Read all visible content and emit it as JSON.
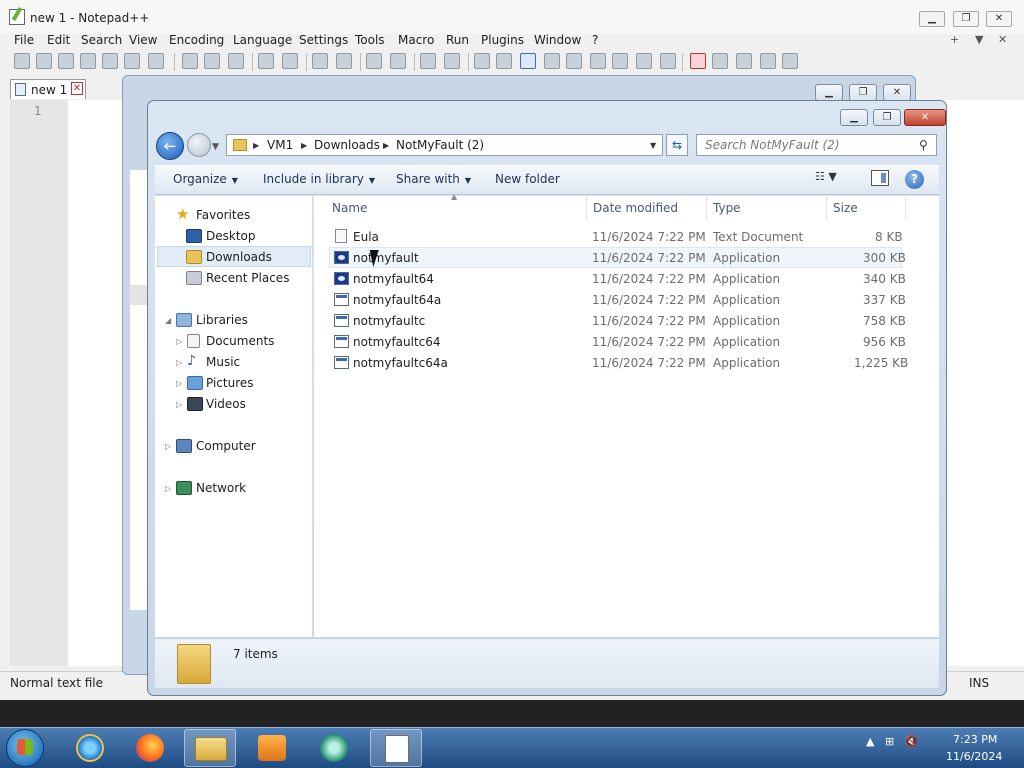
{
  "notepad": {
    "title": "new 1 - Notepad++",
    "menu": [
      "File",
      "Edit",
      "Search",
      "View",
      "Encoding",
      "Language",
      "Settings",
      "Tools",
      "Macro",
      "Run",
      "Plugins",
      "Window",
      "?"
    ],
    "menu_right": [
      "+",
      "▼",
      "✕"
    ],
    "tab": "new 1",
    "line_number": "1",
    "status_left": "Normal text file",
    "status_ins": "INS"
  },
  "explorer": {
    "breadcrumb": [
      "VM1",
      "Downloads",
      "NotMyFault (2)"
    ],
    "search_placeholder": "Search NotMyFault (2)",
    "commands": [
      "Organize",
      "Include in library",
      "Share with",
      "New folder"
    ],
    "nav": {
      "favorites": "Favorites",
      "favorites_items": [
        "Desktop",
        "Downloads",
        "Recent Places"
      ],
      "libraries": "Libraries",
      "libraries_items": [
        "Documents",
        "Music",
        "Pictures",
        "Videos"
      ],
      "computer": "Computer",
      "network": "Network"
    },
    "columns": [
      "Name",
      "Date modified",
      "Type",
      "Size"
    ],
    "files": [
      {
        "name": "Eula",
        "date": "11/6/2024 7:22 PM",
        "type": "Text Document",
        "size": "8 KB",
        "icon": "text-document-icon"
      },
      {
        "name": "notmyfault",
        "date": "11/6/2024 7:22 PM",
        "type": "Application",
        "size": "300 KB",
        "icon": "app-icon"
      },
      {
        "name": "notmyfault64",
        "date": "11/6/2024 7:22 PM",
        "type": "Application",
        "size": "340 KB",
        "icon": "app-icon"
      },
      {
        "name": "notmyfault64a",
        "date": "11/6/2024 7:22 PM",
        "type": "Application",
        "size": "337 KB",
        "icon": "app-icon"
      },
      {
        "name": "notmyfaultc",
        "date": "11/6/2024 7:22 PM",
        "type": "Application",
        "size": "758 KB",
        "icon": "app-icon"
      },
      {
        "name": "notmyfaultc64",
        "date": "11/6/2024 7:22 PM",
        "type": "Application",
        "size": "956 KB",
        "icon": "app-icon"
      },
      {
        "name": "notmyfaultc64a",
        "date": "11/6/2024 7:22 PM",
        "type": "Application",
        "size": "1,225 KB",
        "icon": "app-icon"
      }
    ],
    "item_count": "7 items"
  },
  "taskbar": {
    "time": "7:23 PM",
    "date": "11/6/2024"
  }
}
